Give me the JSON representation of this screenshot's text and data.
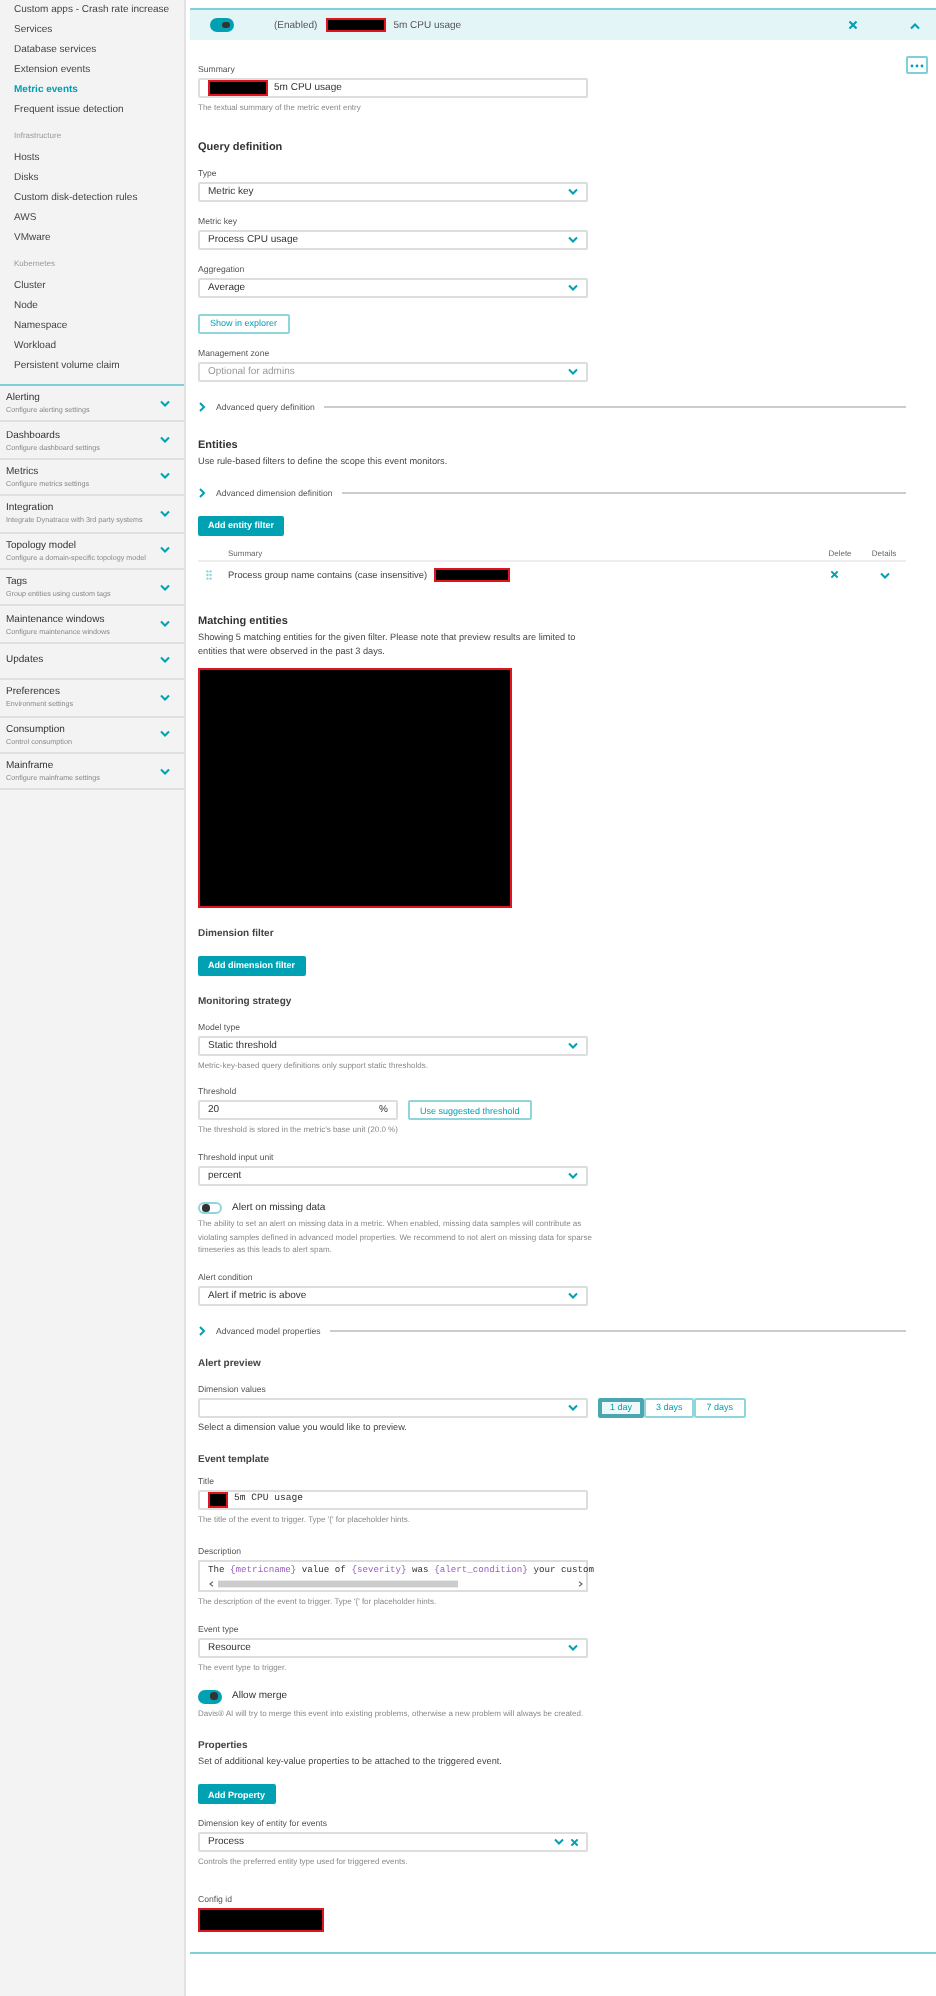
{
  "sidebar": {
    "links": [
      {
        "kind": "link",
        "label": "Custom apps - Crash rate increase",
        "selected": false
      },
      {
        "kind": "link",
        "label": "Services",
        "selected": false
      },
      {
        "kind": "link",
        "label": "Database services",
        "selected": false
      },
      {
        "kind": "link",
        "label": "Extension events",
        "selected": false
      },
      {
        "kind": "link",
        "label": "Metric events",
        "selected": true
      },
      {
        "kind": "link",
        "label": "Frequent issue detection",
        "selected": false
      },
      {
        "kind": "heading",
        "label": "Infrastructure"
      },
      {
        "kind": "link",
        "label": "Hosts",
        "selected": false
      },
      {
        "kind": "link",
        "label": "Disks",
        "selected": false
      },
      {
        "kind": "link",
        "label": "Custom disk-detection rules",
        "selected": false
      },
      {
        "kind": "link",
        "label": "AWS",
        "selected": false
      },
      {
        "kind": "link",
        "label": "VMware",
        "selected": false
      },
      {
        "kind": "heading",
        "label": "Kubernetes"
      },
      {
        "kind": "link",
        "label": "Cluster",
        "selected": false
      },
      {
        "kind": "link",
        "label": "Node",
        "selected": false
      },
      {
        "kind": "link",
        "label": "Namespace",
        "selected": false
      },
      {
        "kind": "link",
        "label": "Workload",
        "selected": false
      },
      {
        "kind": "link",
        "label": "Persistent volume claim",
        "selected": false
      }
    ],
    "categories": [
      {
        "title": "Alerting",
        "subtitle": "Configure alerting settings",
        "expanded": false
      },
      {
        "title": "Dashboards",
        "subtitle": "Configure dashboard settings",
        "expanded": false
      },
      {
        "title": "Metrics",
        "subtitle": "Configure metrics settings",
        "expanded": false
      },
      {
        "title": "Integration",
        "subtitle": "Integrate Dynatrace with 3rd party systems",
        "expanded": false
      },
      {
        "title": "Topology model",
        "subtitle": "Configure a domain-specific topology model",
        "expanded": false
      },
      {
        "title": "Tags",
        "subtitle": "Group entities using custom tags",
        "expanded": false
      },
      {
        "title": "Maintenance windows",
        "subtitle": "Configure maintenance windows",
        "expanded": false
      },
      {
        "title": "Updates",
        "expanded": false
      },
      {
        "title": "Preferences",
        "subtitle": "Environment settings",
        "expanded": false
      },
      {
        "title": "Consumption",
        "subtitle": "Control consumption",
        "expanded": false
      },
      {
        "title": "Mainframe",
        "subtitle": "Configure mainframe settings",
        "expanded": false
      }
    ]
  },
  "header": {
    "enabled": true,
    "status": "(Enabled)",
    "redacted": true,
    "title": "5m CPU usage",
    "expanded": true
  },
  "form": [
    {
      "kind": "text",
      "label": "Summary",
      "redacted": true,
      "value": "5m CPU usage",
      "hint": "The textual summary of the metric event entry"
    },
    {
      "kind": "section",
      "text": "Query definition"
    },
    {
      "kind": "select",
      "label": "Type",
      "value": "Metric key"
    },
    {
      "kind": "select",
      "label": "Metric key",
      "value": "Process CPU usage"
    },
    {
      "kind": "select",
      "label": "Aggregation",
      "value": "Average"
    },
    {
      "kind": "outline_button",
      "label": "Show in explorer"
    },
    {
      "kind": "select",
      "label": "Management zone",
      "placeholder": "Optional for admins"
    },
    {
      "kind": "expander",
      "label": "Advanced query definition",
      "expanded": false
    },
    {
      "kind": "section",
      "text": "Entities"
    },
    {
      "kind": "paragraph",
      "text": "Use rule-based filters to define the scope this event monitors."
    },
    {
      "kind": "expander",
      "label": "Advanced dimension definition",
      "expanded": false
    },
    {
      "kind": "primary_button",
      "label": "Add entity filter"
    },
    {
      "kind": "filter_table",
      "columns": [
        "Summary",
        "Delete",
        "Details"
      ],
      "rows": [
        {
          "summary": "Process group name contains (case insensitive)",
          "redacted": true,
          "expanded": false
        }
      ]
    },
    {
      "kind": "section",
      "text": "Matching entities"
    },
    {
      "kind": "paragraph",
      "text": "Showing 5 matching entities for the given filter. Please note that preview results are limited to entities that were observed in the past 3 days."
    },
    {
      "kind": "redacted_block"
    },
    {
      "kind": "subsection",
      "text": "Dimension filter"
    },
    {
      "kind": "primary_button",
      "label": "Add dimension filter"
    },
    {
      "kind": "subsection",
      "text": "Monitoring strategy"
    },
    {
      "kind": "select",
      "label": "Model type",
      "value": "Static threshold",
      "hint": "Metric-key-based query definitions only support static thresholds."
    },
    {
      "kind": "threshold",
      "label": "Threshold",
      "value": "20",
      "unit": "%",
      "button": "Use suggested threshold",
      "hint": "The threshold is stored in the metric's base unit (20.0 %)"
    },
    {
      "kind": "select",
      "label": "Threshold input unit",
      "value": "percent"
    },
    {
      "kind": "toggle",
      "label": "Alert on missing data",
      "on": false,
      "hint": "The ability to set an alert on missing data in a metric. When enabled, missing data samples will contribute as violating samples defined in advanced model properties. We recommend to not alert on missing data for sparse timeseries as this leads to alert spam."
    },
    {
      "kind": "select",
      "label": "Alert condition",
      "value": "Alert if metric is above"
    },
    {
      "kind": "expander",
      "label": "Advanced model properties",
      "expanded": false
    },
    {
      "kind": "subsection",
      "text": "Alert preview"
    },
    {
      "kind": "range_select",
      "label": "Dimension values",
      "options": [
        {
          "label": "1 day",
          "selected": true
        },
        {
          "label": "3 days",
          "selected": false
        },
        {
          "label": "7 days",
          "selected": false
        }
      ]
    },
    {
      "kind": "paragraph",
      "text": "Select a dimension value you would like to preview."
    },
    {
      "kind": "subsection",
      "text": "Event template"
    },
    {
      "kind": "code_text",
      "label": "Title",
      "redacted": true,
      "value": "5m CPU usage",
      "hint": "The title of the event to trigger. Type '{' for placeholder hints."
    },
    {
      "kind": "code_area",
      "label": "Description",
      "segments": [
        {
          "kind": "plain",
          "text": "The "
        },
        {
          "kind": "placeholder",
          "text": "{metricname}"
        },
        {
          "kind": "plain",
          "text": " value of "
        },
        {
          "kind": "placeholder",
          "text": "{severity}"
        },
        {
          "kind": "plain",
          "text": " was "
        },
        {
          "kind": "placeholder",
          "text": "{alert_condition}"
        },
        {
          "kind": "plain",
          "text": " your custom"
        }
      ],
      "hint": "The description of the event to trigger. Type '{' for placeholder hints."
    },
    {
      "kind": "select",
      "label": "Event type",
      "value": "Resource",
      "hint": "The event type to trigger."
    },
    {
      "kind": "toggle",
      "label": "Allow merge",
      "on": true,
      "hint": "Davis® AI will try to merge this event into existing problems, otherwise a new problem will always be created."
    },
    {
      "kind": "subsection",
      "text": "Properties"
    },
    {
      "kind": "paragraph",
      "text": "Set of additional key-value properties to be attached to the triggered event."
    },
    {
      "kind": "primary_button",
      "label": "Add Property"
    },
    {
      "kind": "select",
      "label": "Dimension key of entity for events",
      "value": "Process",
      "clearable": true,
      "hint": "Controls the preferred entity type used for triggered events."
    },
    {
      "kind": "redacted_value",
      "label": "Config id"
    }
  ]
}
